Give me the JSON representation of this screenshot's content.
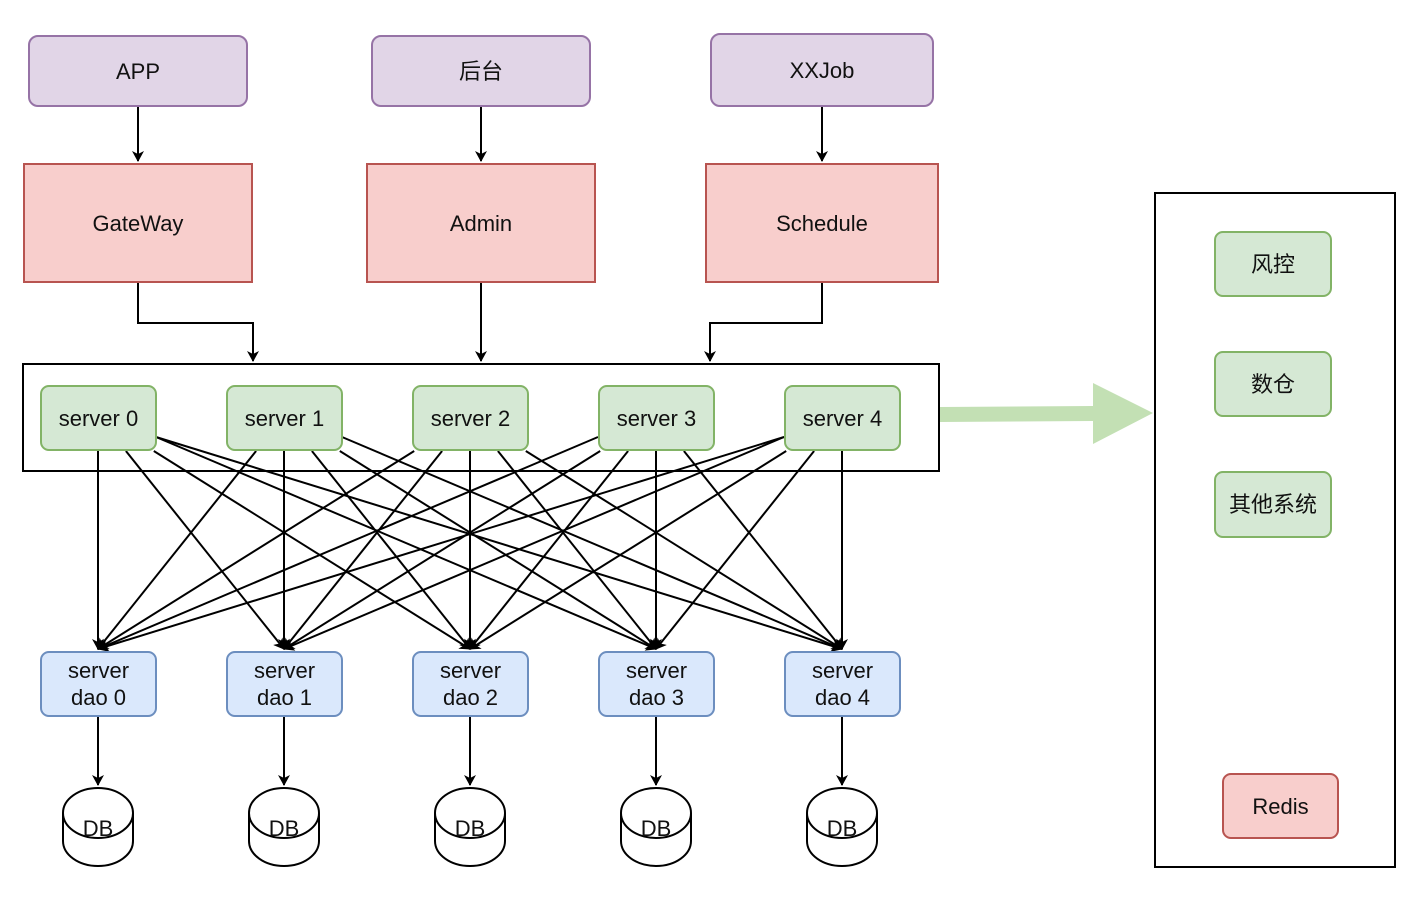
{
  "diagram": {
    "clients": [
      {
        "id": "app",
        "label": "APP"
      },
      {
        "id": "backend",
        "label": "后台"
      },
      {
        "id": "xxjob",
        "label": "XXJob"
      }
    ],
    "services": [
      {
        "id": "gateway",
        "label": "GateWay"
      },
      {
        "id": "admin",
        "label": "Admin"
      },
      {
        "id": "schedule",
        "label": "Schedule"
      }
    ],
    "servers": [
      {
        "label": "server 0"
      },
      {
        "label": "server 1"
      },
      {
        "label": "server 2"
      },
      {
        "label": "server 3"
      },
      {
        "label": "server 4"
      }
    ],
    "daos": [
      {
        "line1": "server",
        "line2": "dao 0"
      },
      {
        "line1": "server",
        "line2": "dao 1"
      },
      {
        "line1": "server",
        "line2": "dao 2"
      },
      {
        "line1": "server",
        "line2": "dao 3"
      },
      {
        "line1": "server",
        "line2": "dao 4"
      }
    ],
    "databases": [
      {
        "label": "DB"
      },
      {
        "label": "DB"
      },
      {
        "label": "DB"
      },
      {
        "label": "DB"
      },
      {
        "label": "DB"
      }
    ],
    "external_systems": [
      {
        "label": "风控"
      },
      {
        "label": "数仓"
      },
      {
        "label": "其他系统"
      }
    ],
    "cache": {
      "label": "Redis"
    },
    "edges": {
      "client_to_service": [
        [
          "app",
          "gateway"
        ],
        [
          "backend",
          "admin"
        ],
        [
          "xxjob",
          "schedule"
        ]
      ],
      "service_to_server_group": [
        "gateway",
        "admin",
        "schedule"
      ],
      "server_to_dao": "all-to-all",
      "dao_to_db": "one-to-one",
      "server_group_to_external": "big-arrow"
    },
    "colors": {
      "client_fill": "#e1d5e7",
      "client_stroke": "#9673a6",
      "service_fill": "#f8cecc",
      "service_stroke": "#b85450",
      "server_fill": "#d5e8d4",
      "server_stroke": "#82b366",
      "dao_fill": "#dae8fc",
      "dao_stroke": "#6c8ebf",
      "big_arrow": "#c3e0b4"
    }
  }
}
